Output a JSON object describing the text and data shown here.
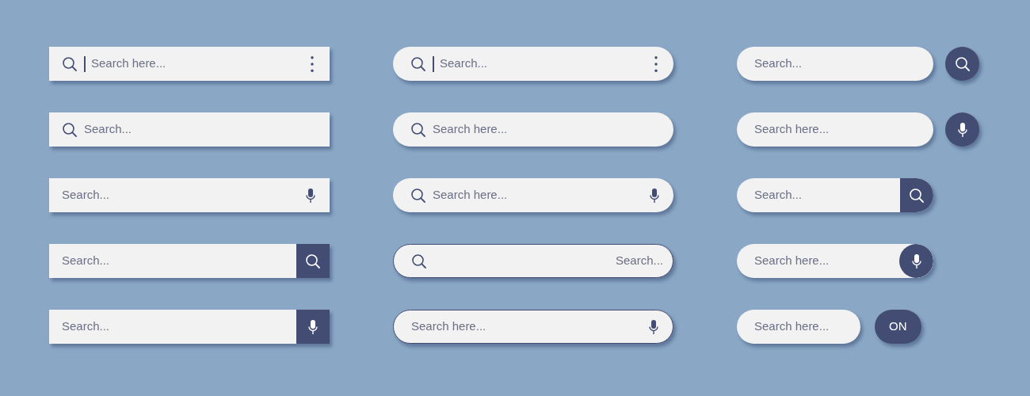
{
  "columns": [
    {
      "kind": "wide",
      "bars": [
        {
          "rounded": false,
          "search_icon": true,
          "cursor": true,
          "placeholder": "Search here...",
          "right_aligned": false,
          "outlined": false,
          "trail": {
            "kind": "menu"
          }
        },
        {
          "rounded": false,
          "search_icon": true,
          "cursor": false,
          "placeholder": "Search...",
          "right_aligned": false,
          "outlined": false
        },
        {
          "rounded": false,
          "search_icon": false,
          "cursor": false,
          "placeholder": "Search...",
          "right_aligned": false,
          "outlined": false,
          "trail": {
            "kind": "mic"
          }
        },
        {
          "rounded": false,
          "search_icon": false,
          "cursor": false,
          "placeholder": "Search...",
          "right_aligned": false,
          "outlined": false,
          "trail": {
            "kind": "search-block"
          }
        },
        {
          "rounded": false,
          "search_icon": false,
          "cursor": false,
          "placeholder": "Search...",
          "right_aligned": false,
          "outlined": false,
          "trail": {
            "kind": "mic-block"
          }
        }
      ]
    },
    {
      "kind": "wide",
      "bars": [
        {
          "rounded": true,
          "search_icon": true,
          "cursor": true,
          "placeholder": "Search...",
          "right_aligned": false,
          "outlined": false,
          "trail": {
            "kind": "menu"
          }
        },
        {
          "rounded": true,
          "search_icon": true,
          "cursor": false,
          "placeholder": "Search here...",
          "right_aligned": false,
          "outlined": false
        },
        {
          "rounded": true,
          "search_icon": true,
          "cursor": false,
          "placeholder": "Search here...",
          "right_aligned": false,
          "outlined": false,
          "trail": {
            "kind": "mic"
          }
        },
        {
          "rounded": true,
          "search_icon": true,
          "cursor": false,
          "placeholder": "Search...",
          "right_aligned": true,
          "outlined": true
        },
        {
          "rounded": true,
          "search_icon": false,
          "cursor": false,
          "placeholder": "Search here...",
          "right_aligned": false,
          "outlined": true,
          "trail": {
            "kind": "mic"
          }
        }
      ]
    },
    {
      "kind": "medium",
      "bars": [
        {
          "rounded": true,
          "search_icon": false,
          "cursor": false,
          "placeholder": "Search...",
          "right_aligned": false,
          "outlined": false,
          "trail": {
            "kind": "search-outside"
          }
        },
        {
          "rounded": true,
          "search_icon": false,
          "cursor": false,
          "placeholder": "Search here...",
          "right_aligned": false,
          "outlined": false,
          "trail": {
            "kind": "mic-outside"
          }
        },
        {
          "rounded": true,
          "search_icon": false,
          "cursor": false,
          "placeholder": "Search...",
          "right_aligned": false,
          "outlined": false,
          "trail": {
            "kind": "search-block"
          }
        },
        {
          "rounded": true,
          "search_icon": false,
          "cursor": false,
          "placeholder": "Search here...",
          "right_aligned": false,
          "outlined": false,
          "trail": {
            "kind": "mic-round"
          }
        },
        {
          "rounded": true,
          "search_icon": false,
          "cursor": false,
          "placeholder": "Search here...",
          "right_aligned": false,
          "outlined": false,
          "trail": {
            "kind": "text-outside",
            "label": "ON"
          }
        }
      ]
    }
  ]
}
